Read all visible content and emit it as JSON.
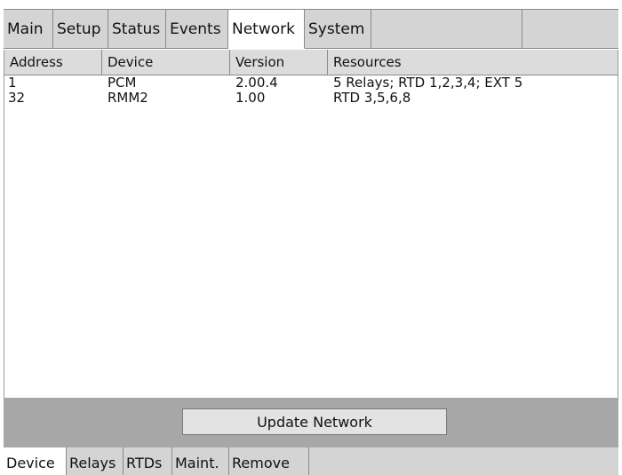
{
  "top_tabs": [
    "Main",
    "Setup",
    "Status",
    "Events",
    "Network",
    "System"
  ],
  "active_top_tab": "Network",
  "table": {
    "columns": [
      "Address",
      "Device",
      "Version",
      "Resources"
    ],
    "rows": [
      [
        "1",
        "PCM",
        "2.00.4",
        "5 Relays; RTD 1,2,3,4; EXT 5"
      ],
      [
        "32",
        "RMM2",
        "1.00",
        "RTD 3,5,6,8"
      ]
    ]
  },
  "update_button": "Update Network",
  "bottom_tabs": [
    "Device",
    "Relays",
    "RTDs",
    "Maint.",
    "Remove"
  ],
  "active_bottom_tab": "Device"
}
